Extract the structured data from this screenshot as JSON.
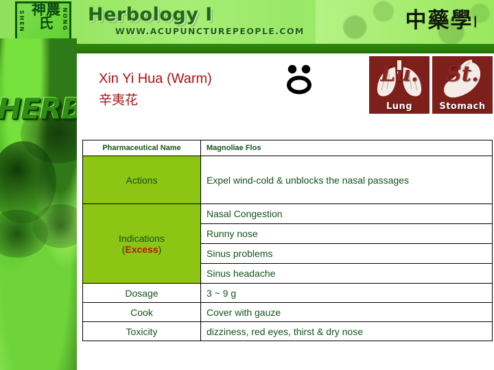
{
  "banner": {
    "title": "Herbology I",
    "url": "WWW.ACUPUNCTUREPEOPLE.COM",
    "chinese_title": "中藥學",
    "chinese_title_number": "I",
    "seal": {
      "chinese": "神農氏",
      "left_text": "SHEN",
      "right_text": "NONG"
    }
  },
  "sidebar": {
    "word": "HERB"
  },
  "herb": {
    "pinyin_name": "Xin Yi Hua (Warm)",
    "chinese_name": "辛夷花",
    "face_icon": "nose-icon"
  },
  "organ_badges": [
    {
      "abbr": "Lu.",
      "caption": "Lung",
      "icon": "lungs-icon"
    },
    {
      "abbr": "St.",
      "caption": "Stomach",
      "icon": "stomach-icon"
    }
  ],
  "table": {
    "pharmaceutical_name_label": "Pharmaceutical Name",
    "pharmaceutical_name_value": "Magnoliae Flos",
    "actions_label": "Actions",
    "actions_value": "Expel wind-cold & unblocks the nasal passages",
    "indications_label": "Indications",
    "indications_sublabel_open": "(",
    "indications_sublabel_bold": "Excess",
    "indications_sublabel_close": ")",
    "indications": [
      "Nasal Congestion",
      "Runny nose",
      "Sinus problems",
      "Sinus headache"
    ],
    "dosage_label": "Dosage",
    "dosage_value": "3 ~ 9 g",
    "cook_label": "Cook",
    "cook_value": "Cover with gauze",
    "toxicity_label": "Toxicity",
    "toxicity_value": " dizziness, red eyes, thirst & dry nose"
  },
  "colors": {
    "green_cell": "#8cc513",
    "text_green": "#14521a",
    "title_red": "#b01010",
    "excess_red": "#b21800",
    "badge_maroon": "#7d1f1b",
    "banner_green": "#9ae867",
    "dark_bar": "#2f8a10"
  }
}
